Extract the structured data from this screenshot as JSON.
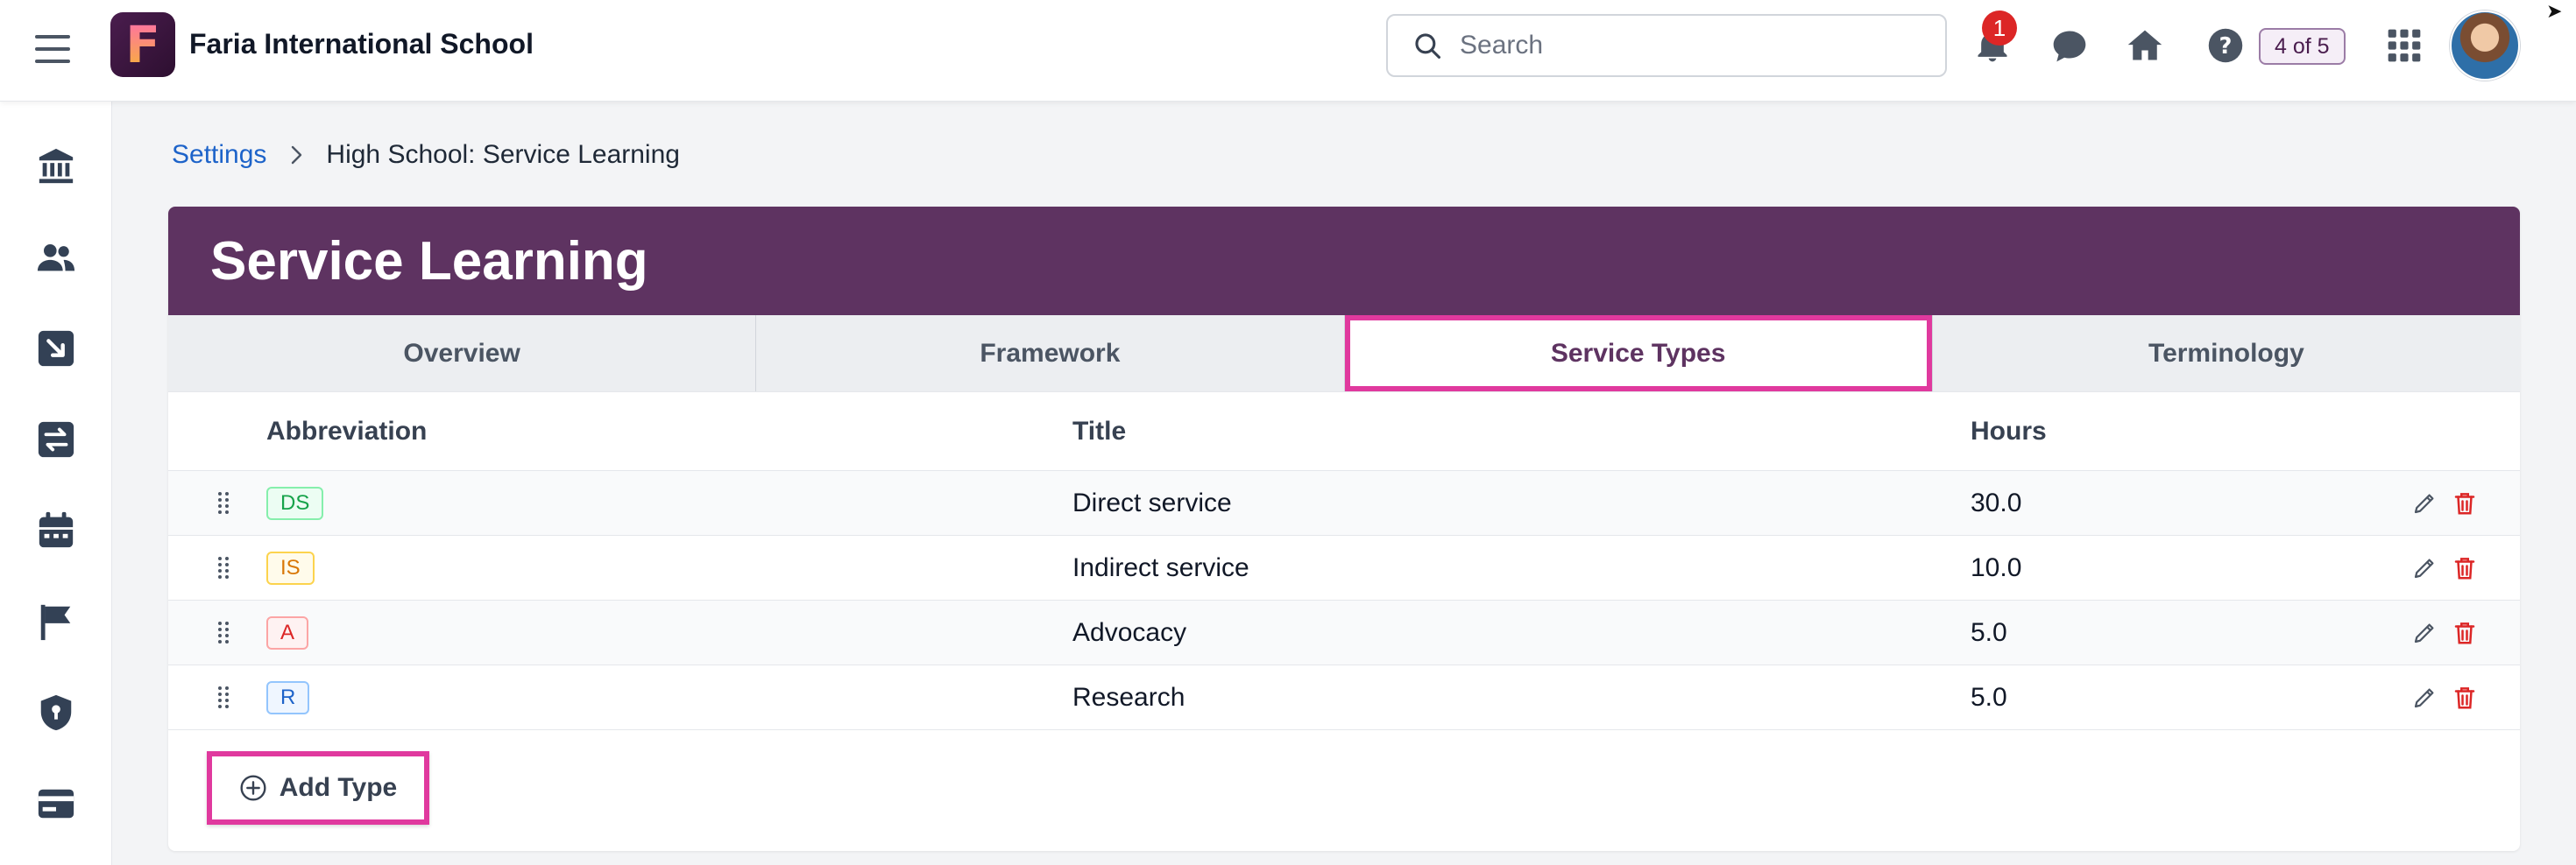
{
  "header": {
    "school_name": "Faria International School",
    "logo_letter": "F",
    "search_placeholder": "Search",
    "notification_count": "1",
    "page_indicator": "4 of 5"
  },
  "breadcrumb": {
    "root": "Settings",
    "current": "High School: Service Learning"
  },
  "page": {
    "title": "Service Learning",
    "tabs": [
      {
        "label": "Overview",
        "active": false
      },
      {
        "label": "Framework",
        "active": false
      },
      {
        "label": "Service Types",
        "active": true
      },
      {
        "label": "Terminology",
        "active": false
      }
    ]
  },
  "table": {
    "headers": {
      "abbreviation": "Abbreviation",
      "title": "Title",
      "hours": "Hours"
    },
    "rows": [
      {
        "abbr": "DS",
        "title": "Direct service",
        "hours": "30.0",
        "color": "#16a34a",
        "bg": "#ecfdf3",
        "border": "#86efac"
      },
      {
        "abbr": "IS",
        "title": "Indirect service",
        "hours": "10.0",
        "color": "#d97706",
        "bg": "#fffbeb",
        "border": "#fcd34d"
      },
      {
        "abbr": "A",
        "title": "Advocacy",
        "hours": "5.0",
        "color": "#dc2626",
        "bg": "#fef2f2",
        "border": "#fca5a5"
      },
      {
        "abbr": "R",
        "title": "Research",
        "hours": "5.0",
        "color": "#1d63c9",
        "bg": "#eff6ff",
        "border": "#93c5fd"
      }
    ]
  },
  "actions": {
    "add_type_label": "Add Type"
  },
  "sidebar": {
    "items": [
      "bank-icon",
      "people-icon",
      "import-icon",
      "transfer-icon",
      "calendar-icon",
      "flag-icon",
      "shield-icon",
      "card-icon"
    ]
  },
  "colors": {
    "brand": "#5e3361",
    "highlight": "#e0399e",
    "link": "#1d63c9",
    "delete": "#dc2626"
  }
}
